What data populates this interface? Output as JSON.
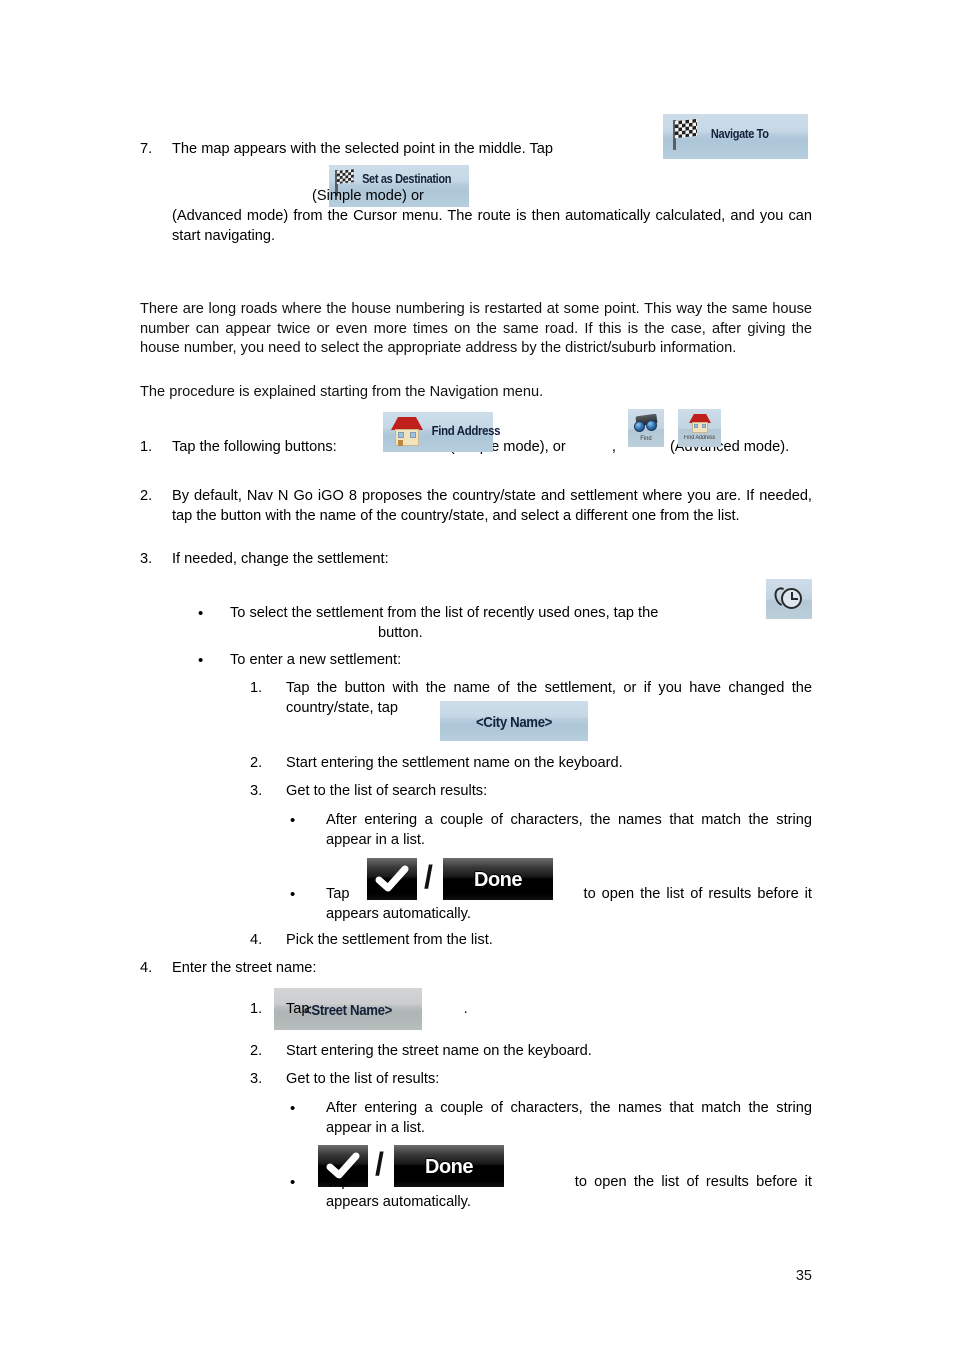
{
  "page": {
    "number": "35"
  },
  "step7": {
    "marker": "7.",
    "text_before_btn1": "The map appears with the selected point in the middle. Tap",
    "text_after_btn1": "(Simple mode) or",
    "text_after_btn2": "(Advanced mode) from the Cursor menu. The route is then automatically calculated, and you can start navigating."
  },
  "intro": {
    "paragraph1": "There are long roads where the house numbering is restarted at some point. This way the same house number can appear twice or even more times on the same road. If this is the case, after giving the house number, you need to select the appropriate address by the district/suburb information.",
    "paragraph2": "The procedure is explained starting from the Navigation menu."
  },
  "steps": {
    "s1": {
      "marker": "1.",
      "text_before": "Tap the following buttons:",
      "text_mid": "(Simple mode), or",
      "comma": ",",
      "text_after": "(Advanced mode)."
    },
    "s2": {
      "marker": "2.",
      "text": "By default, Nav N Go iGO 8 proposes the country/state and settlement where you are. If needed, tap the button with the name of the country/state, and select a different one from the list."
    },
    "s3": {
      "marker": "3.",
      "text": "If needed, change the settlement:",
      "b1_before": "To select the settlement from the list of recently used ones, tap the",
      "b1_after": "button.",
      "b2": "To enter a new settlement:",
      "n1_marker": "1.",
      "n1_before": "Tap the button with the name of the settlement, or if you have changed the country/state, tap",
      "n1_after": ".",
      "n2_marker": "2.",
      "n2": "Start entering the settlement name on the keyboard.",
      "n3_marker": "3.",
      "n3": "Get to the list of search results:",
      "n3_b1": "After entering a couple of characters, the names that match the string appear in a list.",
      "n3_b2_before": "Tap",
      "n3_b2_after": "to open the list of results before it appears automatically.",
      "n4_marker": "4.",
      "n4": "Pick the settlement from the list."
    },
    "s4": {
      "marker": "4.",
      "text": "Enter the street name:",
      "n1_marker": "1.",
      "n1_before": "Tap",
      "n1_after": ".",
      "n2_marker": "2.",
      "n2": "Start entering the street name on the keyboard.",
      "n3_marker": "3.",
      "n3": "Get to the list of results:",
      "n3_b1": "After entering a couple of characters, the names that match the string appear in a list.",
      "n3_b2_before": "Tap",
      "n3_b2_after": "to open the list of results before it appears automatically."
    }
  },
  "buttons": {
    "navigate_to": "Navigate To",
    "set_as_destination": "Set as Destination",
    "find_address": "Find Address",
    "find_mini": "Find",
    "find_address_mini": "Find Address",
    "city_name": "<City Name>",
    "street_name": "<Street Name>",
    "done": "Done",
    "slash": "/"
  },
  "icons": {
    "checkered_flag": "checkered-flag-icon",
    "house": "house-icon",
    "binoculars": "binoculars-icon",
    "history_clock": "history-clock-icon",
    "checkmark": "checkmark-icon",
    "bullet": "•"
  },
  "colors": {
    "igo_blue_button": "#b7cddd",
    "igo_gray_button": "#b8bdbd",
    "igo_black_button": "#000000",
    "roof_red": "#c0201c",
    "house_wall": "#f2e2bd",
    "text": "#111111"
  }
}
